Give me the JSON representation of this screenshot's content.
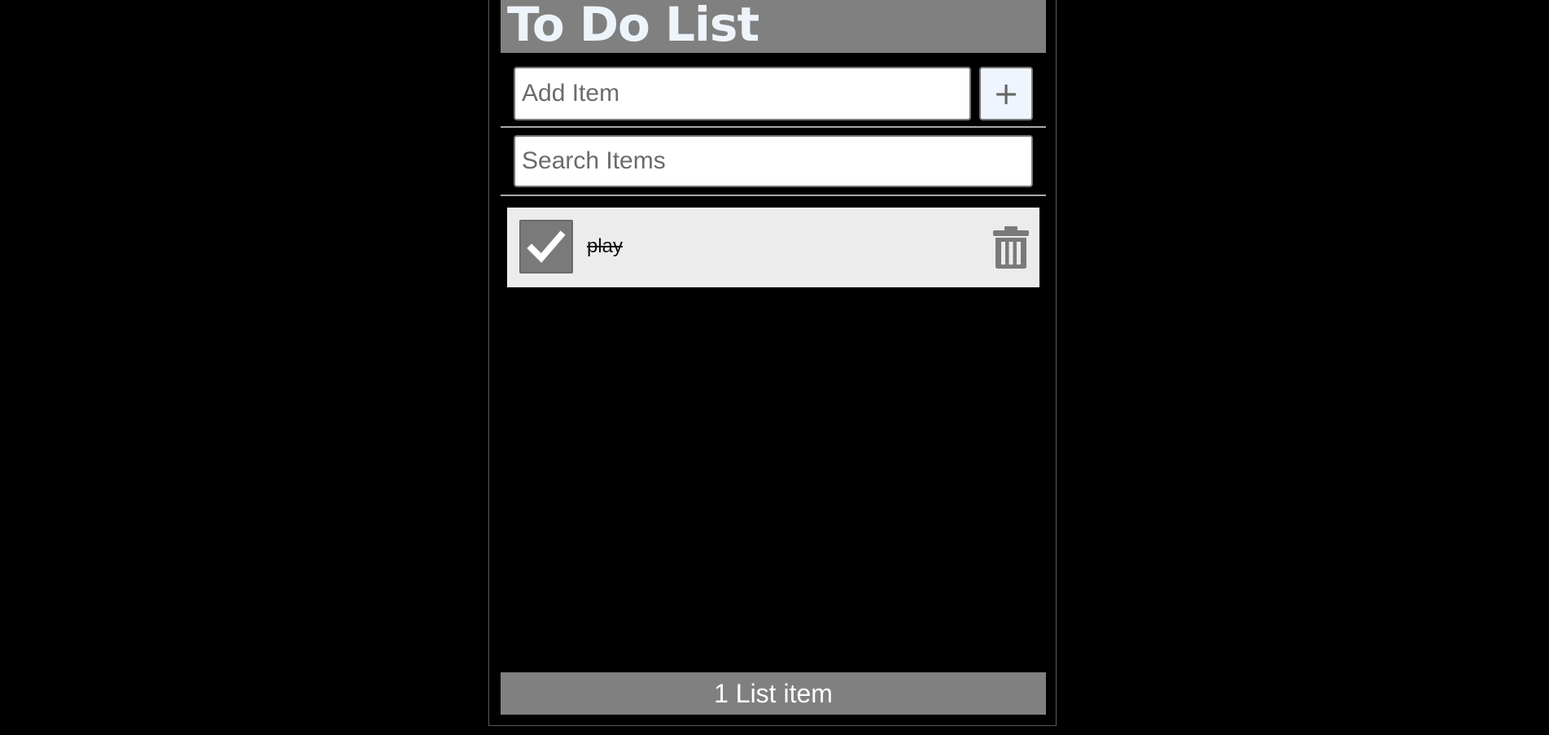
{
  "header": {
    "title": "To Do List"
  },
  "add_form": {
    "input_value": "",
    "input_placeholder": "Add Item",
    "submit_label": "+"
  },
  "search_form": {
    "input_value": "",
    "input_placeholder": "Search Items"
  },
  "items": [
    {
      "label": "play",
      "checked": true
    }
  ],
  "footer": {
    "count_text": "1 List item"
  },
  "colors": {
    "background": "#000000",
    "bar": "#808080",
    "item_background": "#ececec",
    "checkbox": "#7a7a7a",
    "trash_icon": "#7a7a7a",
    "title_text": "#eef4fb"
  },
  "icons": {
    "add": "plus-icon",
    "check": "checkmark-icon",
    "delete": "trash-icon"
  }
}
